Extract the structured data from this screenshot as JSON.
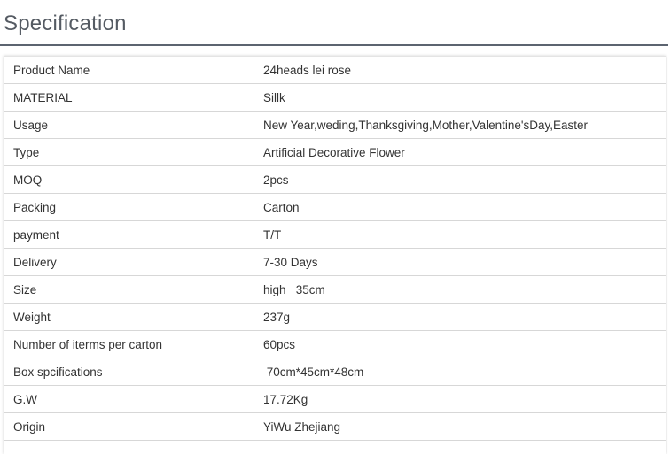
{
  "header": {
    "title": "Specification"
  },
  "spec_rows": [
    {
      "key": "Product Name",
      "value": "24heads lei rose"
    },
    {
      "key": "MATERIAL",
      "value": "Sillk"
    },
    {
      "key": "Usage",
      "value": "New Year,weding,Thanksgiving,Mother,Valentine'sDay,Easter"
    },
    {
      "key": "Type",
      "value": "Artificial Decorative Flower"
    },
    {
      "key": "MOQ",
      "value": "2pcs"
    },
    {
      "key": "Packing",
      "value": "Carton"
    },
    {
      "key": "payment",
      "value": "T/T"
    },
    {
      "key": "Delivery",
      "value": "7-30 Days"
    },
    {
      "key": "Size",
      "value": "high   35cm"
    },
    {
      "key": "Weight",
      "value": "237g"
    },
    {
      "key": "Number of iterms per carton",
      "value": "60pcs"
    },
    {
      "key": "Box spcifications",
      "value": " 70cm*45cm*48cm"
    },
    {
      "key": "G.W",
      "value": "17.72Kg"
    },
    {
      "key": "Origin",
      "value": "YiWu Zhejiang"
    }
  ]
}
